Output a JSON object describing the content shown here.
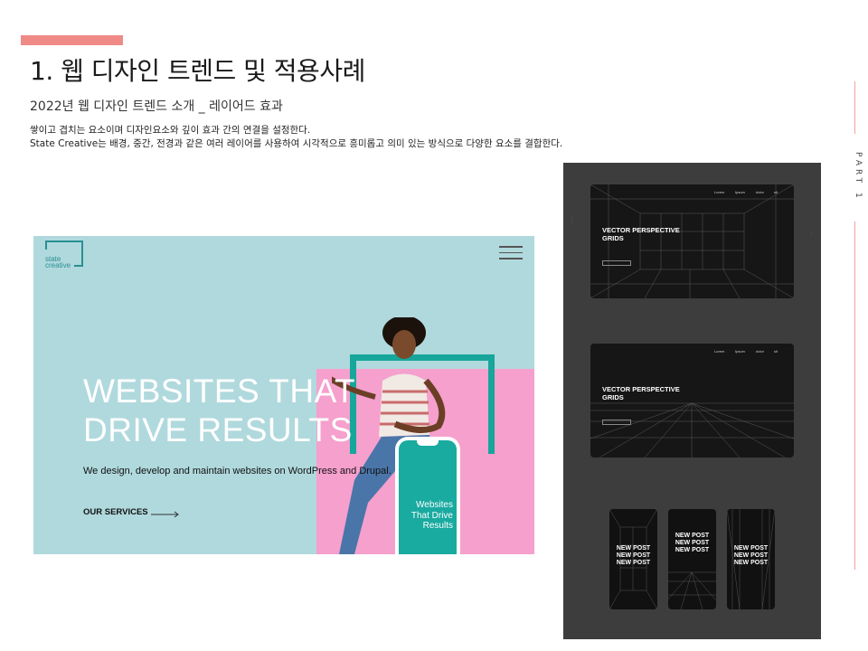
{
  "slide": {
    "title": "1. 웹 디자인 트렌드 및 적용사례",
    "subtitle": "2022년 웹 디자인 트렌드 소개 _ 레이어드 효과",
    "description_line1": "쌓이고 겹치는 요소이며 디자인요소와 깊이 효과 간의 연결을 설정한다.",
    "description_line2": "State Creative는 배경, 중간, 전경과 같은 여러 레이어를 사용하여 시각적으로 흥미롭고 의미 있는 방식으로 다양한 요소를 결합한다.",
    "part_label": "PART 1",
    "accent_color": "#f08a86"
  },
  "left_mockup": {
    "logo_text": "state\ncreative",
    "hero_heading": "WEBSITES THAT\nDRIVE RESULTS",
    "hero_subtext": "We design, develop and maintain websites on WordPress and Drupal.",
    "cta_label": "OUR SERVICES",
    "phone_text": "Websites\nThat Drive\nResults",
    "colors": {
      "background": "#b0d9dd",
      "pink": "#f5a0cd",
      "teal": "#17a69b"
    }
  },
  "right_mockup": {
    "card_heading": "VECTOR PERSPECTIVE\nGRIDS",
    "nav_items": [
      "Lorem",
      "Ipsum",
      "dolor",
      "sit"
    ],
    "phone_heading": "NEW POST\nNEW POST\nNEW POST",
    "colors": {
      "background": "#3d3d3d",
      "card": "#161616"
    }
  }
}
